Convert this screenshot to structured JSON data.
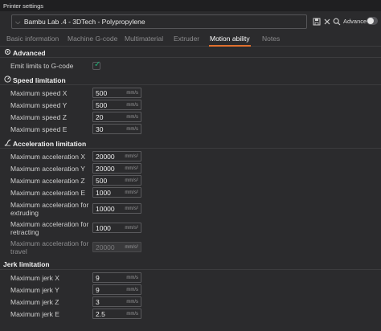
{
  "window": {
    "title": "Printer settings"
  },
  "preset": {
    "caret": "⌵",
    "name": "Bambu Lab .4 - 3DTech - Polypropylene"
  },
  "toolbar": {
    "save_icon": "save-icon",
    "close_icon": "close-icon",
    "search_icon": "search-icon",
    "advanced_label": "Advanced",
    "advanced_on": false
  },
  "tabs": [
    {
      "label": "Basic information",
      "active": false
    },
    {
      "label": "Machine G-code",
      "active": false
    },
    {
      "label": "Multimaterial",
      "active": false
    },
    {
      "label": "Extruder",
      "active": false
    },
    {
      "label": "Motion ability",
      "active": true
    },
    {
      "label": "Notes",
      "active": false
    }
  ],
  "accent_color": "#e0702e",
  "check_color": "#1fae76",
  "sections": {
    "advanced": {
      "title": "Advanced",
      "emit_label": "Emit limits to G-code",
      "emit_checked": true
    },
    "speed": {
      "title": "Speed limitation",
      "rows": [
        {
          "label": "Maximum speed X",
          "value": "500",
          "unit": "mm/s"
        },
        {
          "label": "Maximum speed Y",
          "value": "500",
          "unit": "mm/s"
        },
        {
          "label": "Maximum speed Z",
          "value": "20",
          "unit": "mm/s"
        },
        {
          "label": "Maximum speed E",
          "value": "30",
          "unit": "mm/s"
        }
      ]
    },
    "accel": {
      "title": "Acceleration limitation",
      "rows": [
        {
          "label": "Maximum acceleration X",
          "value": "20000",
          "unit": "mm/s²"
        },
        {
          "label": "Maximum acceleration Y",
          "value": "20000",
          "unit": "mm/s²"
        },
        {
          "label": "Maximum acceleration Z",
          "value": "500",
          "unit": "mm/s²"
        },
        {
          "label": "Maximum acceleration E",
          "value": "1000",
          "unit": "mm/s²"
        },
        {
          "label": "Maximum acceleration for extruding",
          "value": "10000",
          "unit": "mm/s²"
        },
        {
          "label": "Maximum acceleration for retracting",
          "value": "1000",
          "unit": "mm/s²"
        },
        {
          "label": "Maximum acceleration for travel",
          "value": "20000",
          "unit": "mm/s²"
        }
      ]
    },
    "jerk": {
      "title": "Jerk limitation",
      "rows": [
        {
          "label": "Maximum jerk X",
          "value": "9",
          "unit": "mm/s"
        },
        {
          "label": "Maximum jerk Y",
          "value": "9",
          "unit": "mm/s"
        },
        {
          "label": "Maximum jerk Z",
          "value": "3",
          "unit": "mm/s"
        },
        {
          "label": "Maximum jerk E",
          "value": "2.5",
          "unit": "mm/s"
        }
      ]
    }
  }
}
